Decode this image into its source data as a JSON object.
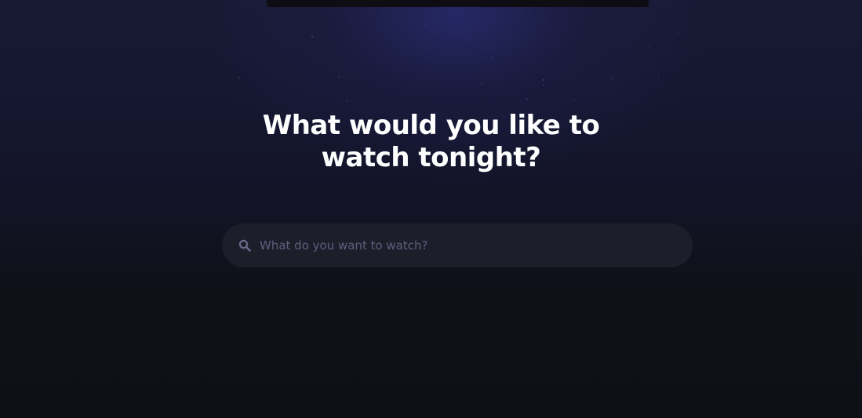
{
  "hero": {
    "headline_line1": "What would you like to",
    "headline_line2": "watch tonight?"
  },
  "search": {
    "placeholder": "What do you want to watch?",
    "value": "",
    "icon": "search-icon"
  },
  "colors": {
    "background": "#0f0f16",
    "glow": "#282a6e",
    "headline": "#ffffff",
    "search_bg": "#1e1e2b",
    "placeholder": "#5e5e7e",
    "icon": "#6a6a8c"
  }
}
